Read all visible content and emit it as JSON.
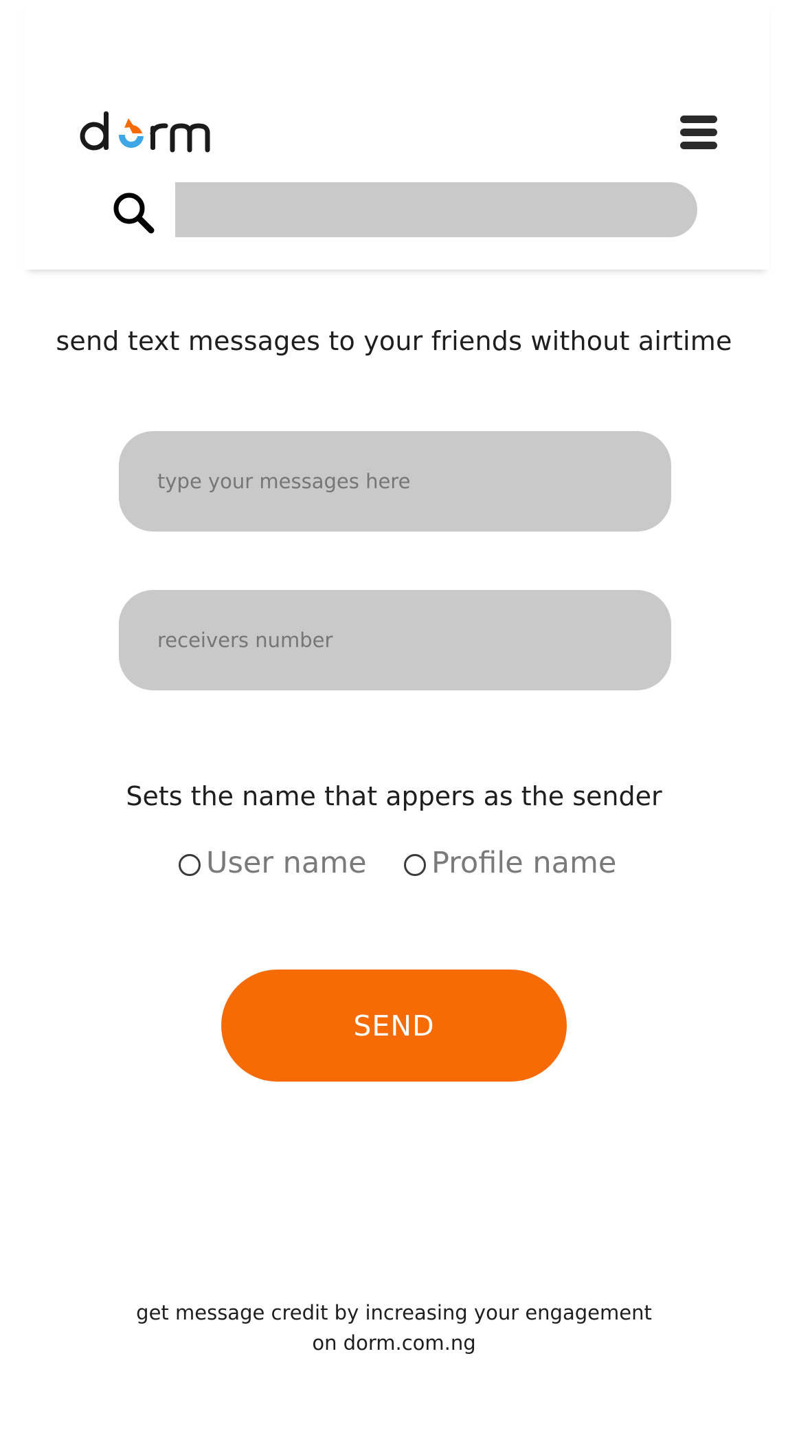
{
  "header": {
    "logo_text": "dorm",
    "colors": {
      "logo_dark": "#1a1a1a",
      "logo_orange": "#f76b07",
      "logo_blue": "#3fa7e6"
    },
    "menu_icon": "hamburger-icon",
    "search_icon": "search-icon",
    "search_value": ""
  },
  "main": {
    "tagline": "send text messages to your friends without airtime",
    "message_placeholder": "type your messages here",
    "number_placeholder": "receivers number",
    "sender_label": "Sets the name that appers as the sender",
    "sender_options": [
      {
        "label": "User name",
        "selected": false
      },
      {
        "label": "Profile name",
        "selected": false
      }
    ],
    "send_label": "SEND",
    "accent_color": "#f76b07",
    "field_color": "#c9c9c9"
  },
  "footer": {
    "line1": "get message credit by increasing your engagement",
    "line2": "on dorm.com.ng"
  }
}
